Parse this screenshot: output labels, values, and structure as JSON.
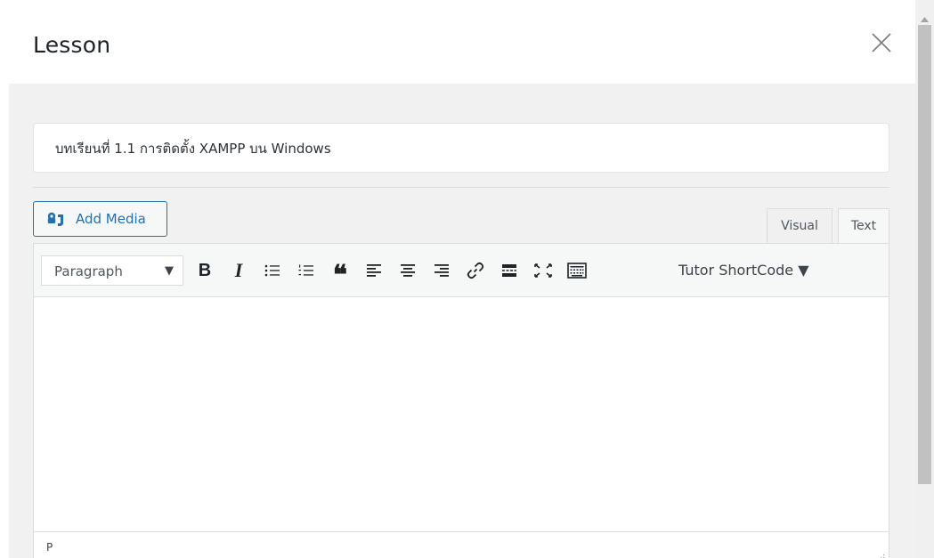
{
  "modal": {
    "title": "Lesson",
    "close_icon": "close-icon"
  },
  "lesson": {
    "title_value": "บทเรียนที่ 1.1 การติดตั้ง XAMPP บน Windows"
  },
  "media": {
    "add_media_label": "Add Media",
    "icon": "media-icon"
  },
  "editor_tabs": {
    "visual": "Visual",
    "text": "Text",
    "active": "Visual"
  },
  "toolbar": {
    "format_value": "Paragraph",
    "format_caret": "▼",
    "bold": "B",
    "italic": "I",
    "blockquote": "❝",
    "buttons": [
      "bold-icon",
      "italic-icon",
      "bulleted-list-icon",
      "numbered-list-icon",
      "blockquote-icon",
      "align-left-icon",
      "align-center-icon",
      "align-right-icon",
      "link-icon",
      "read-more-icon",
      "fullscreen-icon",
      "toolbar-toggle-icon"
    ],
    "shortcode_label": "Tutor ShortCode ▼"
  },
  "editor": {
    "content": "",
    "status_path": "P"
  },
  "colors": {
    "accent": "#2271b1",
    "body_bg": "#f1f1f1",
    "border": "#dcdcde"
  }
}
